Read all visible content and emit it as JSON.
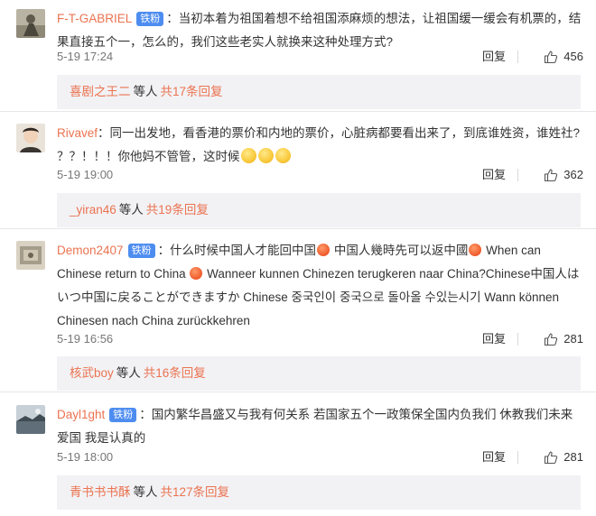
{
  "comments": [
    {
      "user": "F-T-GABRIEL",
      "badge": "铁粉",
      "text_parts": [
        "：当初本着为祖国着想不给祖国添麻烦的想法，让祖国缓一缓会有机票的，结果直接五个一，怎么的，我们这些老实人就换来这种处理方式?"
      ],
      "time": "5-19 17:24",
      "reply_label": "回复",
      "likes": "456",
      "reply_user": "喜剧之王二",
      "reply_etc": "等人",
      "reply_total": "共17条回复"
    },
    {
      "user": "Rivavef",
      "badge": "",
      "text_parts": [
        "：同一出发地，看香港的票价和内地的票价，心脏病都要看出来了，到底谁姓资，谁姓社? ？？！！！你他妈不管管，这时候"
      ],
      "emoji": [
        "smile-emoji",
        "smile-emoji",
        "smile-emoji"
      ],
      "time": "5-19 19:00",
      "reply_label": "回复",
      "likes": "362",
      "reply_user": "_yiran46",
      "reply_etc": "等人",
      "reply_total": "共19条回复"
    },
    {
      "user": "Demon2407",
      "badge": "铁粉",
      "text_parts": [
        "：什么时候中国人才能回中国",
        " 中国人幾時先可以返中國",
        " When can Chinese return to China ",
        " Wanneer kunnen Chinezen terugkeren naar China?Chinese中国人はいつ中国に戻ることができますか Chinese 중국인이 중국으로 돌아올 수있는시기 Wann können Chinesen nach China zurückkehren"
      ],
      "emoji": [
        "angry-emoji",
        "angry-emoji",
        "angry-emoji"
      ],
      "time": "5-19 16:56",
      "reply_label": "回复",
      "likes": "281",
      "reply_user": "核武boy",
      "reply_etc": "等人",
      "reply_total": "共16条回复"
    },
    {
      "user": "Dayl1ght",
      "badge": "铁粉",
      "text_parts": [
        "：国内繁华昌盛又与我有何关系 若国家五个一政策保全国内负我们 休教我们未来爱国 我是认真的"
      ],
      "time": "5-19 18:00",
      "reply_label": "回复",
      "likes": "281",
      "reply_user": "青书书书酥",
      "reply_etc": "等人",
      "reply_total": "共127条回复"
    }
  ],
  "colors": {
    "username": "#eb7350",
    "badge": "#4e8df0",
    "reply_box_bg": "#f2f2f5",
    "meta_text": "#777777"
  },
  "icons": {
    "like": "thumbs-up-icon"
  }
}
